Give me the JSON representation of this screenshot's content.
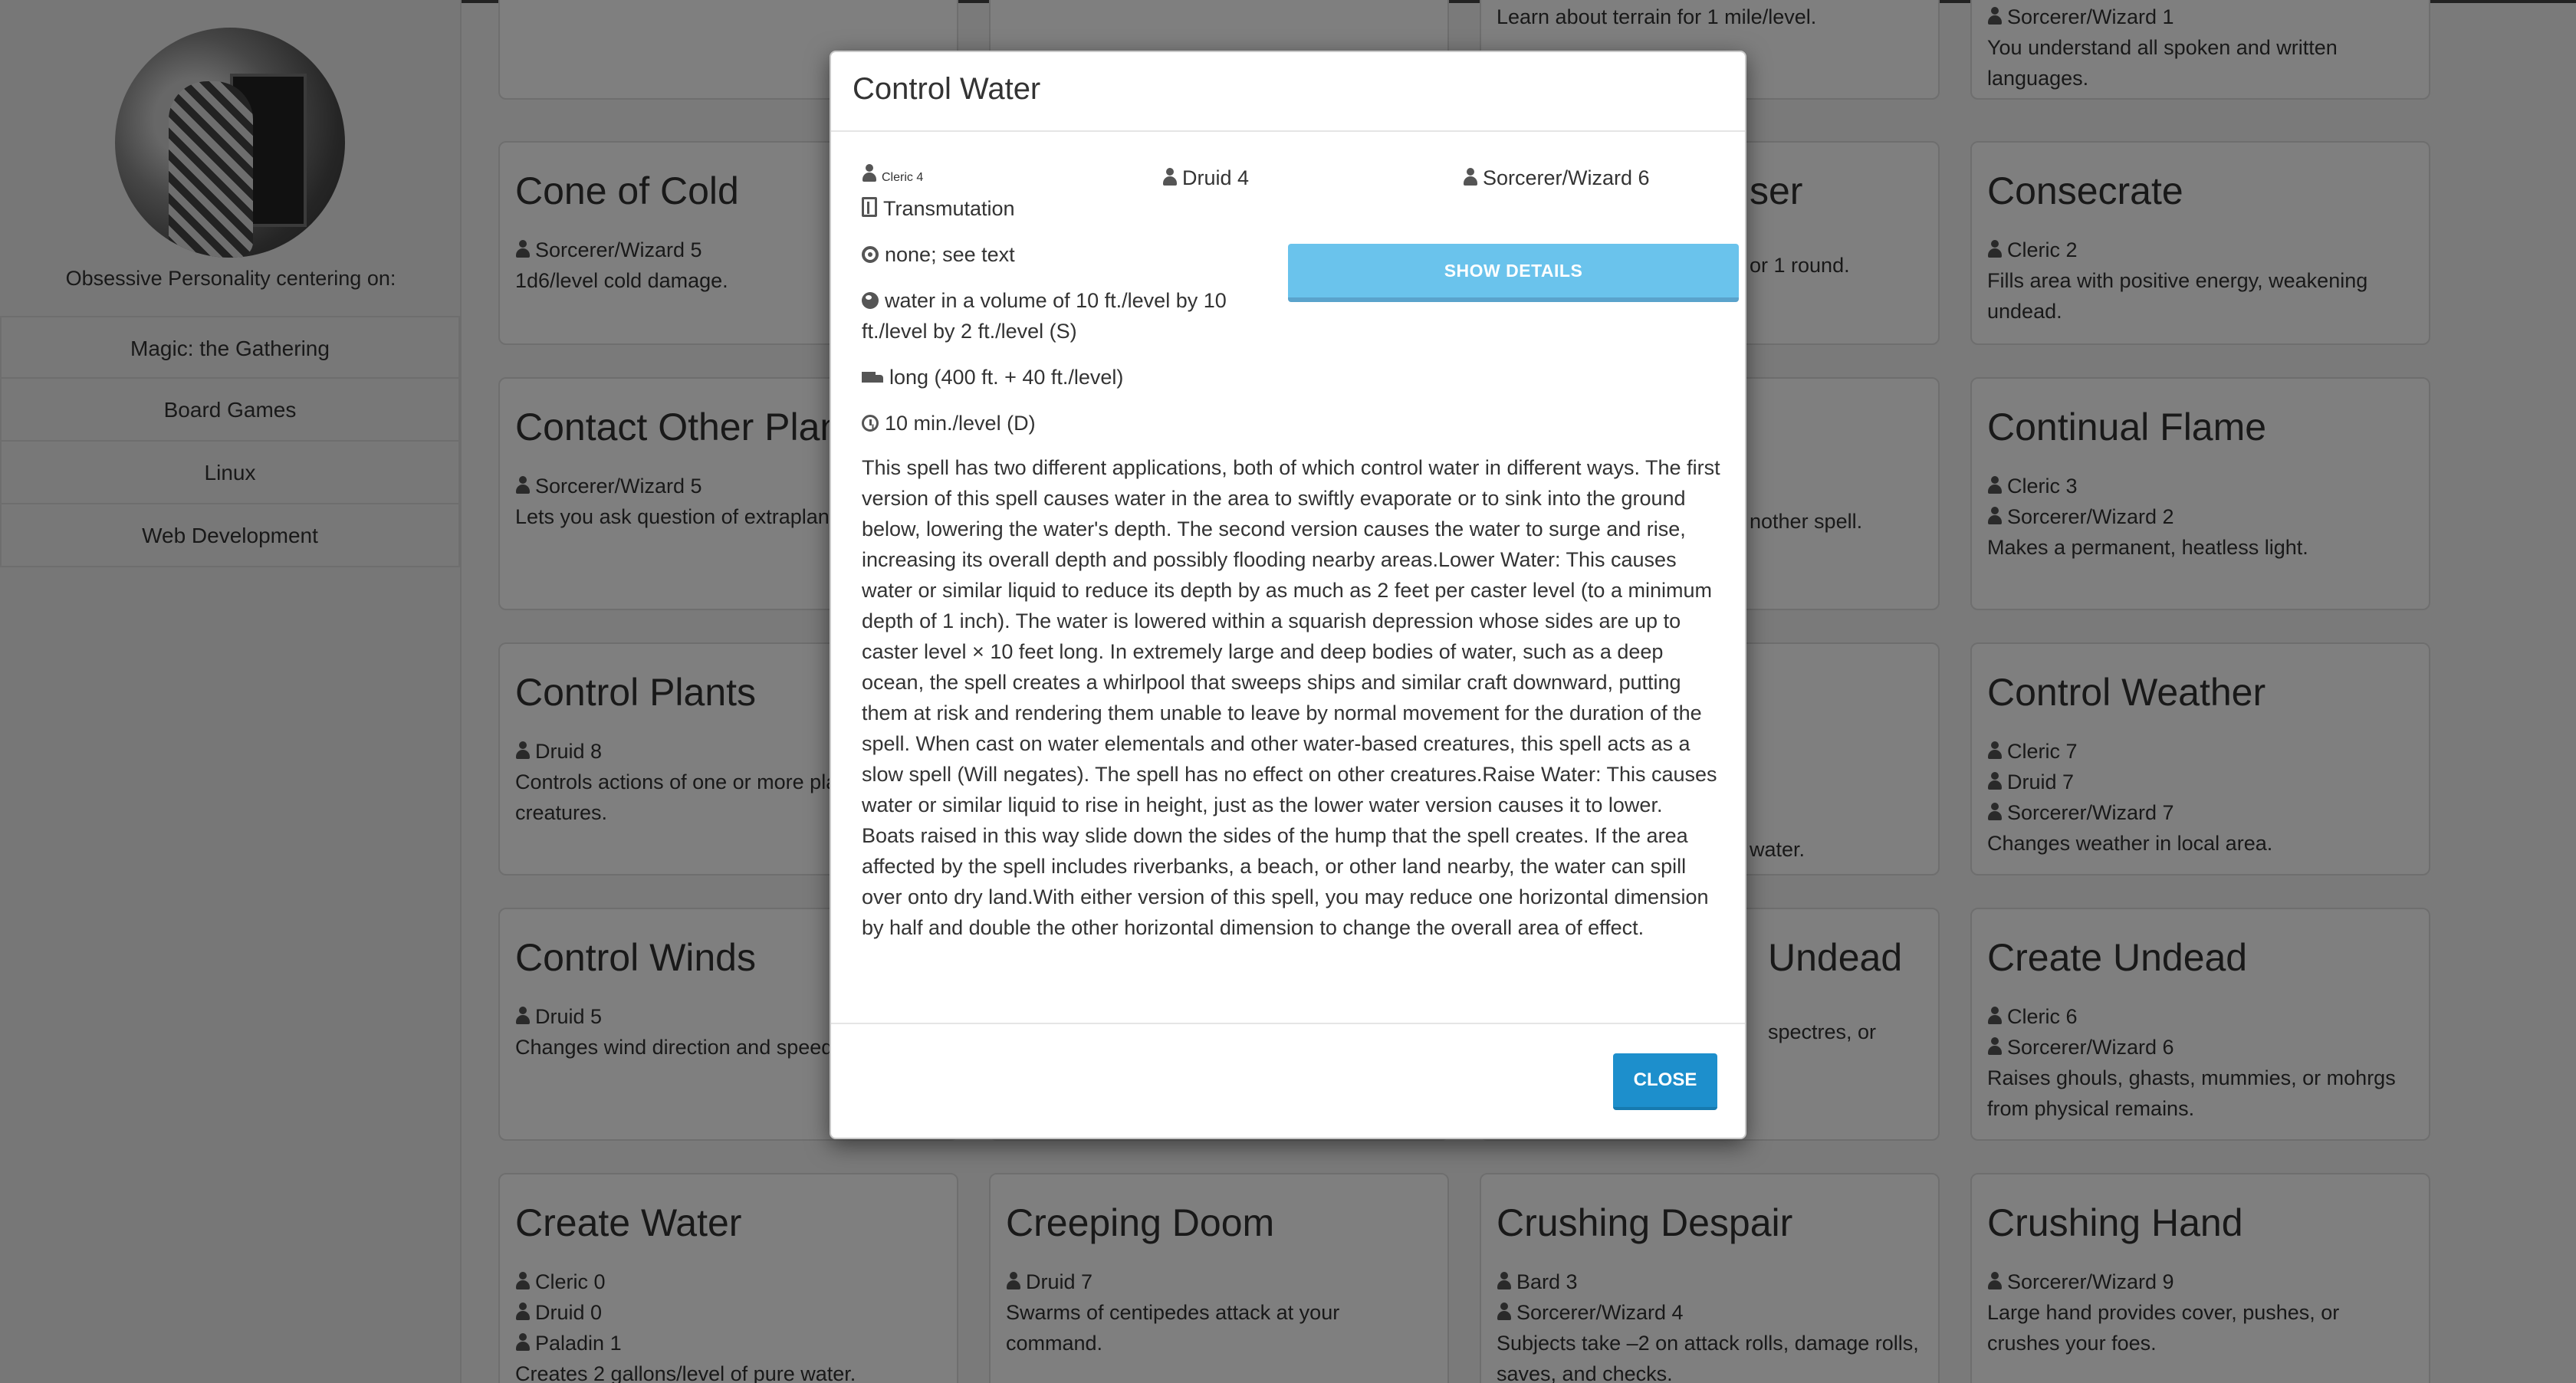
{
  "sidebar": {
    "tagline": "Obsessive Personality centering on:",
    "items": [
      {
        "label": "Magic: the Gathering"
      },
      {
        "label": "Board Games"
      },
      {
        "label": "Linux"
      },
      {
        "label": "Web Development"
      }
    ]
  },
  "cards": {
    "r0c2": {
      "desc": "Learn about terrain for 1 mile/level."
    },
    "r0c3": {
      "cls1": "Sorcerer/Wizard 1",
      "desc": "You understand all spoken and written languages."
    },
    "cone": {
      "title": "Cone of Cold",
      "cls1": "Sorcerer/Wizard 5",
      "desc": "1d6/level cold damage."
    },
    "r1c2": {
      "title": "ser",
      "desc": "or 1 round."
    },
    "consecrate": {
      "title": "Consecrate",
      "cls1": "Cleric 2",
      "desc": "Fills area with positive energy, weakening undead."
    },
    "contact": {
      "title": "Contact Other Plane",
      "cls1": "Sorcerer/Wizard 5",
      "desc": "Lets you ask question of extraplanar entity."
    },
    "r2c2": {
      "desc": "nother spell."
    },
    "flame": {
      "title": "Continual Flame",
      "cls1": "Cleric 3",
      "cls2": "Sorcerer/Wizard 2",
      "desc": "Makes a permanent, heatless light."
    },
    "plants": {
      "title": "Control Plants",
      "cls1": "Druid 8",
      "desc": "Controls actions of one or more plant creatures."
    },
    "r3c2": {
      "desc": "water."
    },
    "weather": {
      "title": "Control Weather",
      "cls1": "Cleric 7",
      "cls2": "Druid 7",
      "cls3": "Sorcerer/Wizard 7",
      "desc": "Changes weather in local area."
    },
    "winds": {
      "title": "Control Winds",
      "cls1": "Druid 5",
      "desc": "Changes wind direction and speed."
    },
    "r4c2": {
      "title": "Undead",
      "desc": "spectres, or"
    },
    "undead": {
      "title": "Create Undead",
      "cls1": "Cleric 6",
      "cls2": "Sorcerer/Wizard 6",
      "desc": "Raises ghouls, ghasts, mummies, or mohrgs from physical remains."
    },
    "water": {
      "title": "Create Water",
      "cls1": "Cleric 0",
      "cls2": "Druid 0",
      "cls3": "Paladin 1",
      "desc": "Creates 2 gallons/level of pure water."
    },
    "doom": {
      "title": "Creeping Doom",
      "cls1": "Druid 7",
      "desc": "Swarms of centipedes attack at your command."
    },
    "despair": {
      "title": "Crushing Despair",
      "cls1": "Bard 3",
      "cls2": "Sorcerer/Wizard 4",
      "desc": "Subjects take –2 on attack rolls, damage rolls, saves, and checks."
    },
    "hand": {
      "title": "Crushing Hand",
      "cls1": "Sorcerer/Wizard 9",
      "desc": "Large hand provides cover, pushes, or crushes your foes."
    }
  },
  "modal": {
    "title": "Control Water",
    "classes": [
      "Cleric 4",
      "Druid 4",
      "Sorcerer/Wizard 6"
    ],
    "school": "Transmutation",
    "components": "none; see text",
    "area": "water in a volume of 10 ft./level by 10 ft./level by 2 ft./level (S)",
    "range": "long (400 ft. + 40 ft./level)",
    "duration": "10 min./level (D)",
    "show_details_label": "SHOW DETAILS",
    "description": "This spell has two different applications, both of which control water in different ways. The first version of this spell causes water in the area to swiftly evaporate or to sink into the ground below, lowering the water's depth. The second version causes the water to surge and rise, increasing its overall depth and possibly flooding nearby areas.Lower Water: This causes water or similar liquid to reduce its depth by as much as 2 feet per caster level (to a minimum depth of 1 inch). The water is lowered within a squarish depression whose sides are up to caster level × 10 feet long. In extremely large and deep bodies of water, such as a deep ocean, the spell creates a whirlpool that sweeps ships and similar craft downward, putting them at risk and rendering them unable to leave by normal movement for the duration of the spell. When cast on water elementals and other water-based creatures, this spell acts as a slow spell (Will negates). The spell has no effect on other creatures.Raise Water: This causes water or similar liquid to rise in height, just as the lower water version causes it to lower. Boats raised in this way slide down the sides of the hump that the spell creates. If the area affected by the spell includes riverbanks, a beach, or other land nearby, the water can spill over onto dry land.With either version of this spell, you may reduce one horizontal dimension by half and double the other horizontal dimension to change the overall area of effect.",
    "close_label": "CLOSE"
  }
}
